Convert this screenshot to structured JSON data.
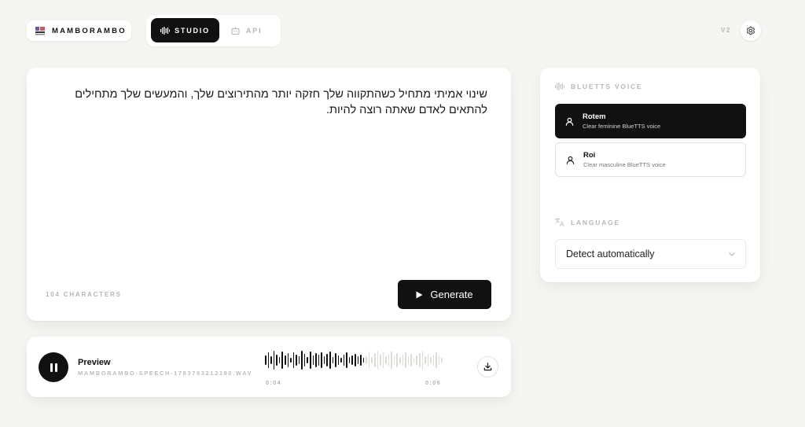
{
  "brand": {
    "name": "MAMBORAMBO"
  },
  "nav": {
    "studio_label": "STUDIO",
    "api_label": "API"
  },
  "header": {
    "version": "V2"
  },
  "editor": {
    "text": "שינוי אמיתי מתחיל כשהתקווה שלך חזקה יותר מהתירוצים שלך, והמעשים שלך מתחילים להתאים לאדם שאתה רוצה להיות.",
    "char_count": "104 CHARACTERS",
    "generate_label": "Generate"
  },
  "preview": {
    "title": "Preview",
    "filename": "MAMBORAMBO-SPEECH-1783793212190.WAV",
    "current_time": "0:04",
    "total_time": "0:06",
    "progress": 0.56,
    "bars": [
      12,
      20,
      10,
      24,
      14,
      8,
      22,
      12,
      18,
      6,
      20,
      14,
      10,
      24,
      16,
      8,
      22,
      12,
      18,
      14,
      20,
      10,
      16,
      22,
      8,
      18,
      12,
      6,
      14,
      20,
      8,
      12,
      16,
      10,
      14,
      6,
      10,
      22,
      8,
      18,
      24,
      14,
      20,
      10,
      16,
      22,
      12,
      18,
      8,
      14,
      20,
      10,
      16,
      6,
      12,
      18,
      24,
      10,
      16,
      8,
      14,
      20,
      12,
      6
    ]
  },
  "voice_panel": {
    "voice_heading": "BLUETTS VOICE",
    "voices": [
      {
        "name": "Rotem",
        "description": "Clear feminine BlueTTS voice",
        "selected": true
      },
      {
        "name": "Roi",
        "description": "Clear masculine BlueTTS voice",
        "selected": false
      }
    ],
    "language_heading": "LANGUAGE",
    "language_value": "Detect automatically"
  },
  "colors": {
    "accent": "#111111",
    "background": "#f5f5f2",
    "waveform_played": "#111111",
    "waveform_unplayed": "#dcdcd7"
  }
}
